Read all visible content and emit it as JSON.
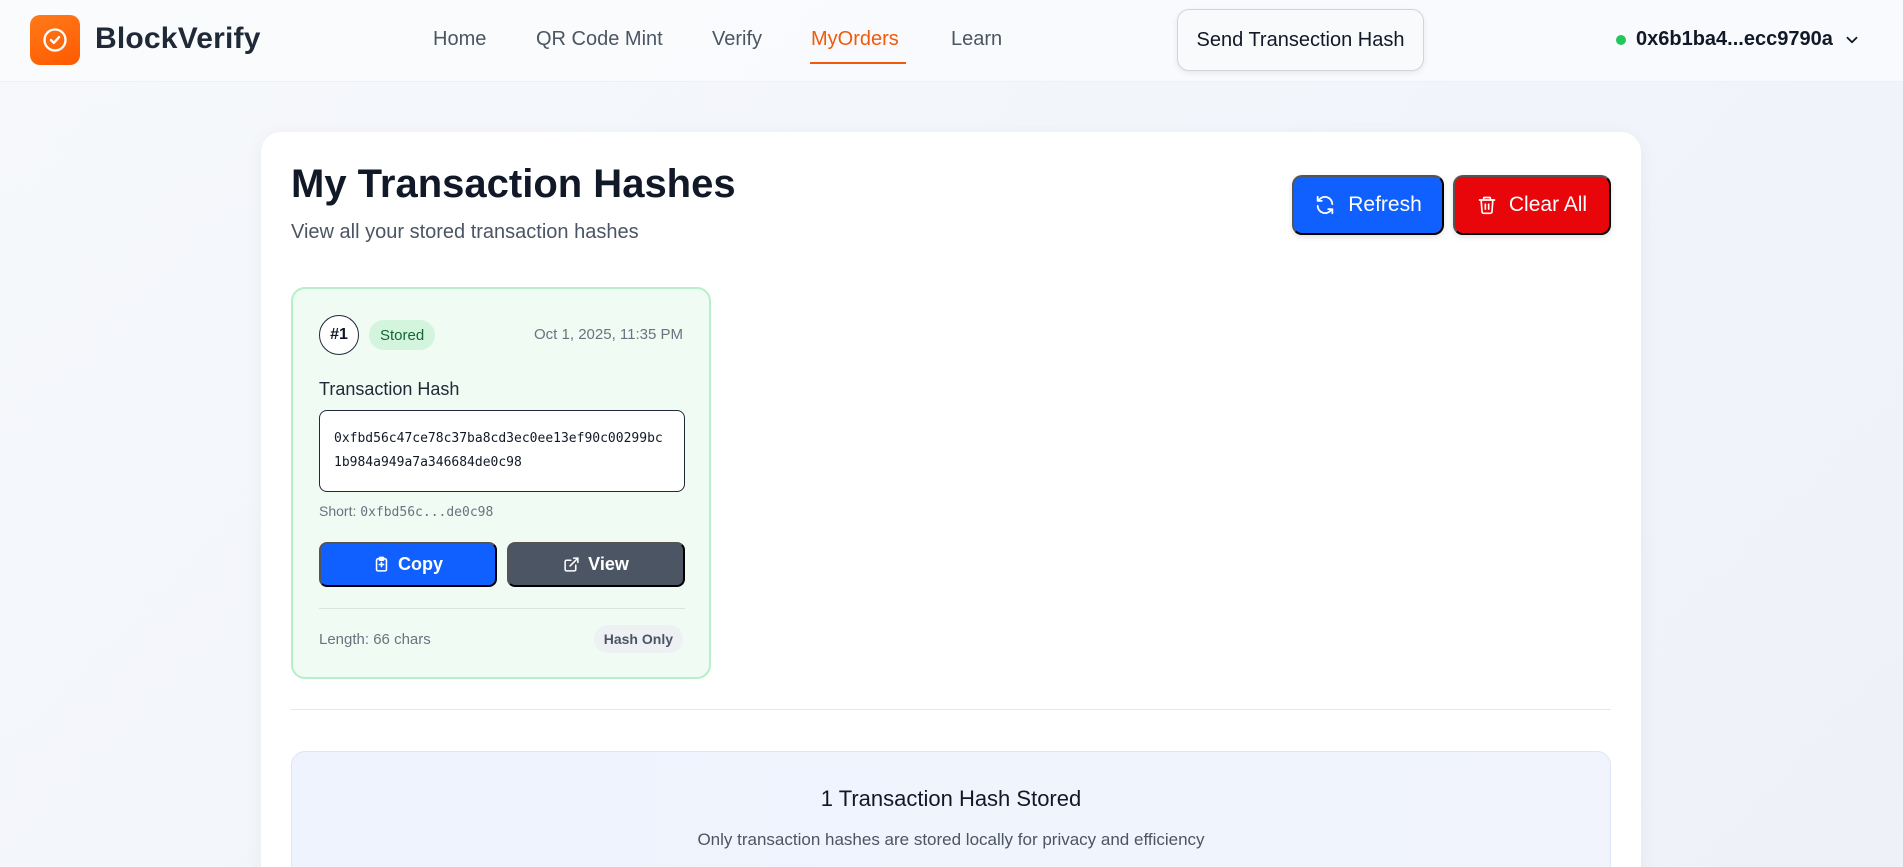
{
  "header": {
    "brand": "BlockVerify",
    "nav": [
      {
        "label": "Home",
        "active": false
      },
      {
        "label": "QR Code Mint",
        "active": false
      },
      {
        "label": "Verify",
        "active": false
      },
      {
        "label": "MyOrders",
        "active": true
      },
      {
        "label": "Learn",
        "active": false
      }
    ],
    "send_button": "Send Transection Hash",
    "wallet_address": "0x6b1ba4...ecc9790a",
    "wallet_status_color": "#22c55e"
  },
  "page": {
    "title": "My Transaction Hashes",
    "subtitle": "View all your stored transaction hashes",
    "refresh_label": "Refresh",
    "clear_label": "Clear All"
  },
  "hashes": [
    {
      "number": "#1",
      "status": "Stored",
      "date": "Oct 1, 2025, 11:35 PM",
      "label": "Transaction Hash",
      "hash": "0xfbd56c47ce78c37ba8cd3ec0ee13ef90c00299bc1b984a949a7a346684de0c98",
      "short_prefix": "Short:",
      "short": "0xfbd56c...de0c98",
      "copy_label": "Copy",
      "view_label": "View",
      "length": "Length: 66 chars",
      "type_badge": "Hash Only"
    }
  ],
  "summary": {
    "title": "1 Transaction Hash Stored",
    "subtitle": "Only transaction hashes are stored locally for privacy and efficiency"
  },
  "colors": {
    "accent_orange": "#f05a0a",
    "primary_blue": "#1060ff",
    "danger_red": "#e8060b",
    "success_green": "#22c55e"
  },
  "icons": [
    "check-circle-icon",
    "refresh-icon",
    "trash-icon",
    "clipboard-icon",
    "external-link-icon",
    "chevron-down-icon"
  ]
}
